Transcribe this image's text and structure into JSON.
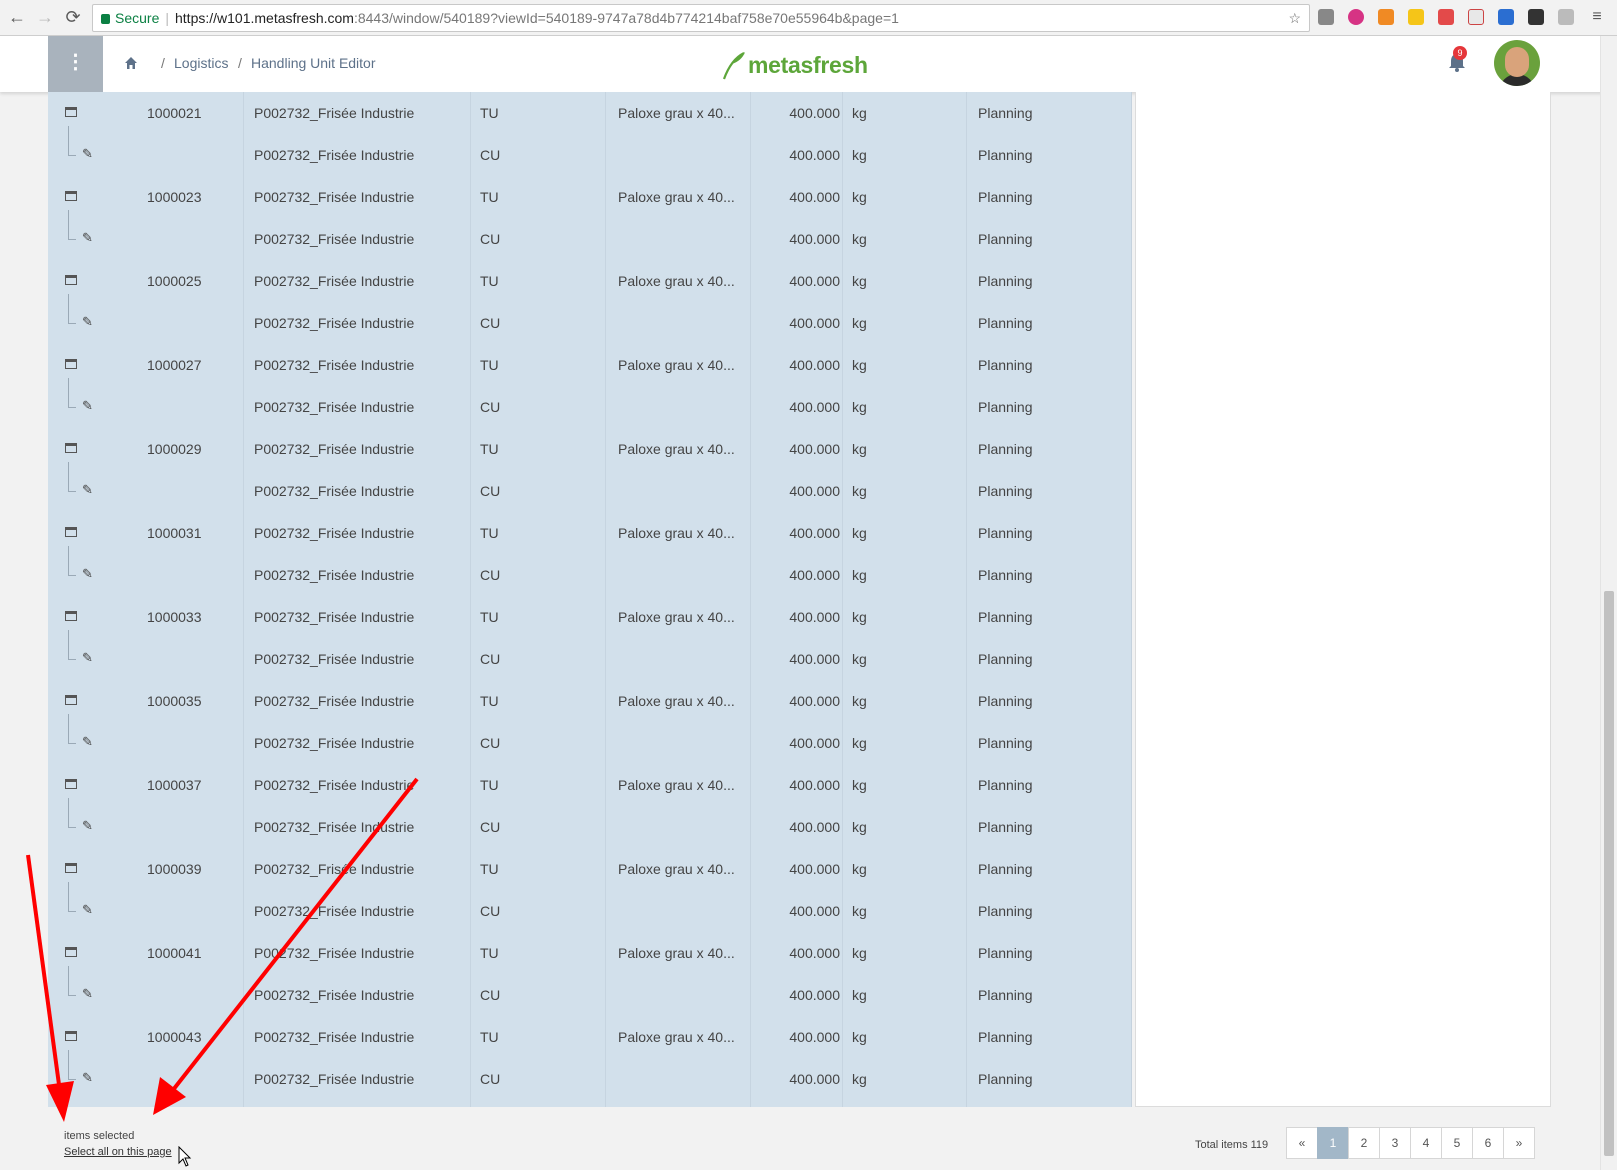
{
  "browser": {
    "secure_label": "Secure",
    "url_host": "https://w101.metasfresh.com",
    "url_rest": ":8443/window/540189?viewId=540189-9747a78d4b774214baf758e70e55964b&page=1"
  },
  "header": {
    "menu_icon": "⋮",
    "breadcrumb": [
      "Logistics",
      "Handling Unit Editor"
    ],
    "logo_text": "metasfresh",
    "notification_count": "9"
  },
  "table": {
    "rows": [
      {
        "type": "TU",
        "id": "1000021",
        "product": "P002732_Frisée Industrie",
        "hu_type": "TU",
        "packing": "Paloxe grau x 40...",
        "qty": "400.000",
        "uom": "kg",
        "status": "Planning"
      },
      {
        "type": "CU",
        "id": "",
        "product": "P002732_Frisée Industrie",
        "hu_type": "CU",
        "packing": "",
        "qty": "400.000",
        "uom": "kg",
        "status": "Planning"
      },
      {
        "type": "TU",
        "id": "1000023",
        "product": "P002732_Frisée Industrie",
        "hu_type": "TU",
        "packing": "Paloxe grau x 40...",
        "qty": "400.000",
        "uom": "kg",
        "status": "Planning"
      },
      {
        "type": "CU",
        "id": "",
        "product": "P002732_Frisée Industrie",
        "hu_type": "CU",
        "packing": "",
        "qty": "400.000",
        "uom": "kg",
        "status": "Planning"
      },
      {
        "type": "TU",
        "id": "1000025",
        "product": "P002732_Frisée Industrie",
        "hu_type": "TU",
        "packing": "Paloxe grau x 40...",
        "qty": "400.000",
        "uom": "kg",
        "status": "Planning"
      },
      {
        "type": "CU",
        "id": "",
        "product": "P002732_Frisée Industrie",
        "hu_type": "CU",
        "packing": "",
        "qty": "400.000",
        "uom": "kg",
        "status": "Planning"
      },
      {
        "type": "TU",
        "id": "1000027",
        "product": "P002732_Frisée Industrie",
        "hu_type": "TU",
        "packing": "Paloxe grau x 40...",
        "qty": "400.000",
        "uom": "kg",
        "status": "Planning"
      },
      {
        "type": "CU",
        "id": "",
        "product": "P002732_Frisée Industrie",
        "hu_type": "CU",
        "packing": "",
        "qty": "400.000",
        "uom": "kg",
        "status": "Planning"
      },
      {
        "type": "TU",
        "id": "1000029",
        "product": "P002732_Frisée Industrie",
        "hu_type": "TU",
        "packing": "Paloxe grau x 40...",
        "qty": "400.000",
        "uom": "kg",
        "status": "Planning"
      },
      {
        "type": "CU",
        "id": "",
        "product": "P002732_Frisée Industrie",
        "hu_type": "CU",
        "packing": "",
        "qty": "400.000",
        "uom": "kg",
        "status": "Planning"
      },
      {
        "type": "TU",
        "id": "1000031",
        "product": "P002732_Frisée Industrie",
        "hu_type": "TU",
        "packing": "Paloxe grau x 40...",
        "qty": "400.000",
        "uom": "kg",
        "status": "Planning"
      },
      {
        "type": "CU",
        "id": "",
        "product": "P002732_Frisée Industrie",
        "hu_type": "CU",
        "packing": "",
        "qty": "400.000",
        "uom": "kg",
        "status": "Planning"
      },
      {
        "type": "TU",
        "id": "1000033",
        "product": "P002732_Frisée Industrie",
        "hu_type": "TU",
        "packing": "Paloxe grau x 40...",
        "qty": "400.000",
        "uom": "kg",
        "status": "Planning"
      },
      {
        "type": "CU",
        "id": "",
        "product": "P002732_Frisée Industrie",
        "hu_type": "CU",
        "packing": "",
        "qty": "400.000",
        "uom": "kg",
        "status": "Planning"
      },
      {
        "type": "TU",
        "id": "1000035",
        "product": "P002732_Frisée Industrie",
        "hu_type": "TU",
        "packing": "Paloxe grau x 40...",
        "qty": "400.000",
        "uom": "kg",
        "status": "Planning"
      },
      {
        "type": "CU",
        "id": "",
        "product": "P002732_Frisée Industrie",
        "hu_type": "CU",
        "packing": "",
        "qty": "400.000",
        "uom": "kg",
        "status": "Planning"
      },
      {
        "type": "TU",
        "id": "1000037",
        "product": "P002732_Frisée Industrie",
        "hu_type": "TU",
        "packing": "Paloxe grau x 40...",
        "qty": "400.000",
        "uom": "kg",
        "status": "Planning"
      },
      {
        "type": "CU",
        "id": "",
        "product": "P002732_Frisée Industrie",
        "hu_type": "CU",
        "packing": "",
        "qty": "400.000",
        "uom": "kg",
        "status": "Planning"
      },
      {
        "type": "TU",
        "id": "1000039",
        "product": "P002732_Frisée Industrie",
        "hu_type": "TU",
        "packing": "Paloxe grau x 40...",
        "qty": "400.000",
        "uom": "kg",
        "status": "Planning"
      },
      {
        "type": "CU",
        "id": "",
        "product": "P002732_Frisée Industrie",
        "hu_type": "CU",
        "packing": "",
        "qty": "400.000",
        "uom": "kg",
        "status": "Planning"
      },
      {
        "type": "TU",
        "id": "1000041",
        "product": "P002732_Frisée Industrie",
        "hu_type": "TU",
        "packing": "Paloxe grau x 40...",
        "qty": "400.000",
        "uom": "kg",
        "status": "Planning"
      },
      {
        "type": "CU",
        "id": "",
        "product": "P002732_Frisée Industrie",
        "hu_type": "CU",
        "packing": "",
        "qty": "400.000",
        "uom": "kg",
        "status": "Planning"
      },
      {
        "type": "TU",
        "id": "1000043",
        "product": "P002732_Frisée Industrie",
        "hu_type": "TU",
        "packing": "Paloxe grau x 40...",
        "qty": "400.000",
        "uom": "kg",
        "status": "Planning"
      },
      {
        "type": "CU",
        "id": "",
        "product": "P002732_Frisée Industrie",
        "hu_type": "CU",
        "packing": "",
        "qty": "400.000",
        "uom": "kg",
        "status": "Planning"
      }
    ]
  },
  "footer": {
    "items_selected": "items selected",
    "select_all": "Select all on this page",
    "total_items": "Total items 119",
    "pages": [
      "«",
      "1",
      "2",
      "3",
      "4",
      "5",
      "6",
      "»"
    ],
    "active_page": "1"
  },
  "colors": {
    "table_bg": "#d2e0eb",
    "brand_green": "#5da63a",
    "annotation_red": "#ff0000"
  }
}
